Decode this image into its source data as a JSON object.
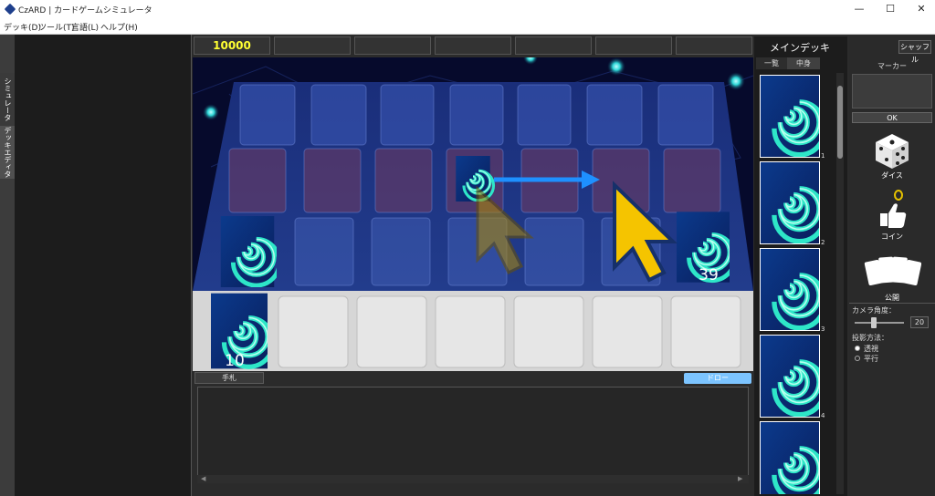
{
  "window": {
    "title": "CzARD | カードゲームシミュレータ",
    "minimize": "—",
    "maximize": "☐",
    "close": "✕"
  },
  "menu": [
    "デッキ(D)",
    "ツール(T)",
    "言語(L)",
    "ヘルプ(H)"
  ],
  "side_tabs": [
    "シミュレータ",
    "デッキエディタ"
  ],
  "score": {
    "life": "10000"
  },
  "board": {
    "grave_count": "39",
    "deck_count": "10"
  },
  "hand": {
    "tab_label": "手札",
    "draw_label": "ドロー"
  },
  "deck_panel": {
    "title": "メインデッキ",
    "tabs": [
      "一覧",
      "中身"
    ],
    "card_numbers": [
      "1",
      "2",
      "3",
      "4"
    ]
  },
  "tools": {
    "shuffle_label": "シャッフル",
    "marker_label": "マーカー",
    "ok_label": "OK",
    "dice_label": "ダイス",
    "coin_label": "コイン",
    "reveal_label": "公開",
    "camera_angle_label": "カメラ角度：",
    "camera_angle_value": "20",
    "projection_label": "投影方法：",
    "projection_options": [
      "透視",
      "平行"
    ],
    "projection_selected": "透視"
  },
  "colors": {
    "accent": "#7cc4ff",
    "life": "#ffff33",
    "arrow": "#1e90ff",
    "cursor": "#f5c400"
  }
}
